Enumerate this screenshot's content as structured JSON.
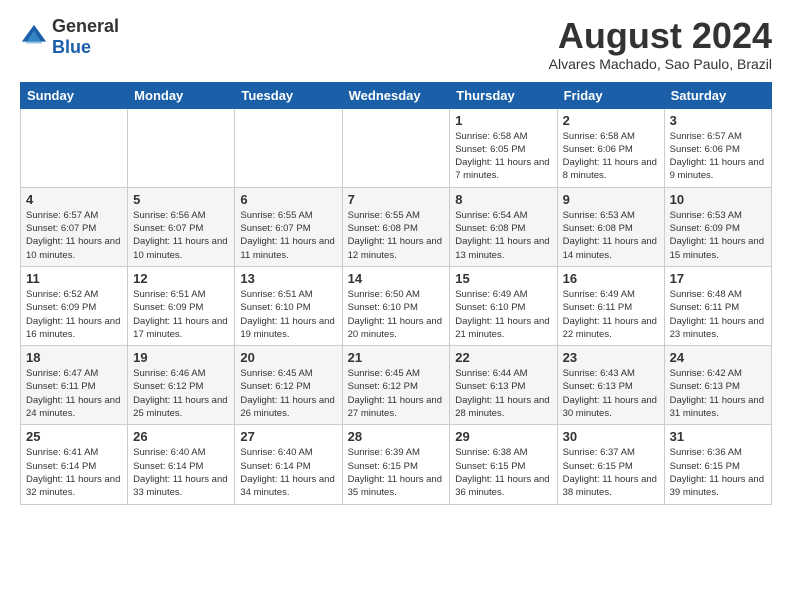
{
  "header": {
    "logo": {
      "general": "General",
      "blue": "Blue"
    },
    "title": "August 2024",
    "location": "Alvares Machado, Sao Paulo, Brazil"
  },
  "calendar": {
    "weekdays": [
      "Sunday",
      "Monday",
      "Tuesday",
      "Wednesday",
      "Thursday",
      "Friday",
      "Saturday"
    ],
    "weeks": [
      [
        {
          "day": "",
          "detail": ""
        },
        {
          "day": "",
          "detail": ""
        },
        {
          "day": "",
          "detail": ""
        },
        {
          "day": "",
          "detail": ""
        },
        {
          "day": "1",
          "detail": "Sunrise: 6:58 AM\nSunset: 6:05 PM\nDaylight: 11 hours\nand 7 minutes."
        },
        {
          "day": "2",
          "detail": "Sunrise: 6:58 AM\nSunset: 6:06 PM\nDaylight: 11 hours\nand 8 minutes."
        },
        {
          "day": "3",
          "detail": "Sunrise: 6:57 AM\nSunset: 6:06 PM\nDaylight: 11 hours\nand 9 minutes."
        }
      ],
      [
        {
          "day": "4",
          "detail": "Sunrise: 6:57 AM\nSunset: 6:07 PM\nDaylight: 11 hours\nand 10 minutes."
        },
        {
          "day": "5",
          "detail": "Sunrise: 6:56 AM\nSunset: 6:07 PM\nDaylight: 11 hours\nand 10 minutes."
        },
        {
          "day": "6",
          "detail": "Sunrise: 6:55 AM\nSunset: 6:07 PM\nDaylight: 11 hours\nand 11 minutes."
        },
        {
          "day": "7",
          "detail": "Sunrise: 6:55 AM\nSunset: 6:08 PM\nDaylight: 11 hours\nand 12 minutes."
        },
        {
          "day": "8",
          "detail": "Sunrise: 6:54 AM\nSunset: 6:08 PM\nDaylight: 11 hours\nand 13 minutes."
        },
        {
          "day": "9",
          "detail": "Sunrise: 6:53 AM\nSunset: 6:08 PM\nDaylight: 11 hours\nand 14 minutes."
        },
        {
          "day": "10",
          "detail": "Sunrise: 6:53 AM\nSunset: 6:09 PM\nDaylight: 11 hours\nand 15 minutes."
        }
      ],
      [
        {
          "day": "11",
          "detail": "Sunrise: 6:52 AM\nSunset: 6:09 PM\nDaylight: 11 hours\nand 16 minutes."
        },
        {
          "day": "12",
          "detail": "Sunrise: 6:51 AM\nSunset: 6:09 PM\nDaylight: 11 hours\nand 17 minutes."
        },
        {
          "day": "13",
          "detail": "Sunrise: 6:51 AM\nSunset: 6:10 PM\nDaylight: 11 hours\nand 19 minutes."
        },
        {
          "day": "14",
          "detail": "Sunrise: 6:50 AM\nSunset: 6:10 PM\nDaylight: 11 hours\nand 20 minutes."
        },
        {
          "day": "15",
          "detail": "Sunrise: 6:49 AM\nSunset: 6:10 PM\nDaylight: 11 hours\nand 21 minutes."
        },
        {
          "day": "16",
          "detail": "Sunrise: 6:49 AM\nSunset: 6:11 PM\nDaylight: 11 hours\nand 22 minutes."
        },
        {
          "day": "17",
          "detail": "Sunrise: 6:48 AM\nSunset: 6:11 PM\nDaylight: 11 hours\nand 23 minutes."
        }
      ],
      [
        {
          "day": "18",
          "detail": "Sunrise: 6:47 AM\nSunset: 6:11 PM\nDaylight: 11 hours\nand 24 minutes."
        },
        {
          "day": "19",
          "detail": "Sunrise: 6:46 AM\nSunset: 6:12 PM\nDaylight: 11 hours\nand 25 minutes."
        },
        {
          "day": "20",
          "detail": "Sunrise: 6:45 AM\nSunset: 6:12 PM\nDaylight: 11 hours\nand 26 minutes."
        },
        {
          "day": "21",
          "detail": "Sunrise: 6:45 AM\nSunset: 6:12 PM\nDaylight: 11 hours\nand 27 minutes."
        },
        {
          "day": "22",
          "detail": "Sunrise: 6:44 AM\nSunset: 6:13 PM\nDaylight: 11 hours\nand 28 minutes."
        },
        {
          "day": "23",
          "detail": "Sunrise: 6:43 AM\nSunset: 6:13 PM\nDaylight: 11 hours\nand 30 minutes."
        },
        {
          "day": "24",
          "detail": "Sunrise: 6:42 AM\nSunset: 6:13 PM\nDaylight: 11 hours\nand 31 minutes."
        }
      ],
      [
        {
          "day": "25",
          "detail": "Sunrise: 6:41 AM\nSunset: 6:14 PM\nDaylight: 11 hours\nand 32 minutes."
        },
        {
          "day": "26",
          "detail": "Sunrise: 6:40 AM\nSunset: 6:14 PM\nDaylight: 11 hours\nand 33 minutes."
        },
        {
          "day": "27",
          "detail": "Sunrise: 6:40 AM\nSunset: 6:14 PM\nDaylight: 11 hours\nand 34 minutes."
        },
        {
          "day": "28",
          "detail": "Sunrise: 6:39 AM\nSunset: 6:15 PM\nDaylight: 11 hours\nand 35 minutes."
        },
        {
          "day": "29",
          "detail": "Sunrise: 6:38 AM\nSunset: 6:15 PM\nDaylight: 11 hours\nand 36 minutes."
        },
        {
          "day": "30",
          "detail": "Sunrise: 6:37 AM\nSunset: 6:15 PM\nDaylight: 11 hours\nand 38 minutes."
        },
        {
          "day": "31",
          "detail": "Sunrise: 6:36 AM\nSunset: 6:15 PM\nDaylight: 11 hours\nand 39 minutes."
        }
      ]
    ]
  }
}
